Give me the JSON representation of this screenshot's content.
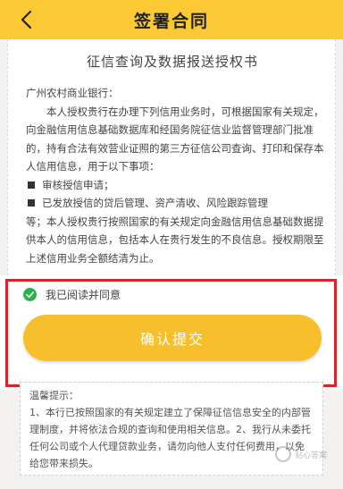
{
  "header": {
    "title": "签署合同",
    "back_icon": "chevron-left-icon"
  },
  "document": {
    "title": "征信查询及数据报送授权书",
    "salutation": "广州农村商业银行：",
    "para1": "本人授权贵行在办理下列信用业务时，可根据国家有关规定，向金融信用信息基础数据库和经国务院征信业监督管理部门批准的，持有合法有效营业证照的第三方征信公司查询、打印和保存本人信用信息，用于以下事项：",
    "item1": "审核授信申请；",
    "item2_start": "已发放授信的贷后管理、资产清收、风险跟踪管理",
    "para2": "等；本人授权贵行按照国家的有关规定向金融信用信息基础数据提供本人的信用信息，包括本人在贵行发生的不良信息。授权期限至上述信用业务全额结清为止。"
  },
  "agreement": {
    "checkbox_label": "我已阅读并同意",
    "checked": true,
    "confirm_label": "确认提交"
  },
  "tips": {
    "title": "温馨提示：",
    "text": "1、本行已按照国家的有关规定建立了保障征信信息安全的内部管理制度，并将依法合规的查询和使用相关信息。2、我行从未委托任何公司或个人代理贷款业务，请勿向他人支付任何费用，以免给您带来损失。"
  },
  "watermark": {
    "text": "贴心答案"
  },
  "colors": {
    "header_yellow": "#fbc934",
    "button_yellow": "#f7bf2c",
    "check_green": "#2bb24c",
    "highlight_red": "#d9242b"
  }
}
